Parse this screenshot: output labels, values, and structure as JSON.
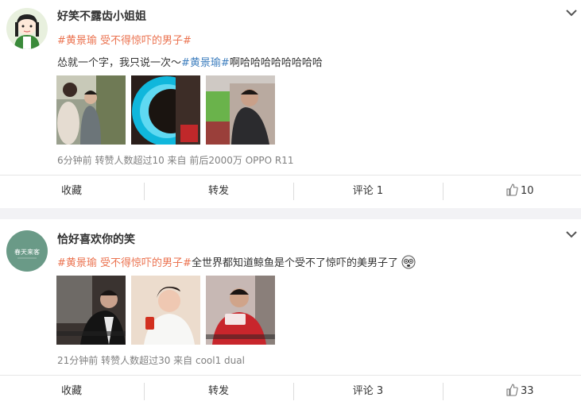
{
  "posts": [
    {
      "username": "好笑不露齿小姐姐",
      "tag_line": {
        "tag_a": "#黄景瑜",
        "tag_b": "受不得惊吓的男子#"
      },
      "text_line": {
        "prefix": "怂就一个字，我只说一次～",
        "tag": "#黄景瑜#",
        "suffix": "啊哈哈哈哈哈哈哈哈"
      },
      "meta": "6分钟前  转赞人数超过10  来自  前后2000万 OPPO R11",
      "actions": {
        "collect": "收藏",
        "repost": "转发",
        "comment": "评论 1",
        "likes": "10"
      }
    },
    {
      "username": "恰好喜欢你的笑",
      "avatar_text": "春天来客",
      "tag_line": {
        "tag_a": "#黄景瑜",
        "tag_b": "受不得惊吓的男子#",
        "suffix": "全世界都知道鲸鱼是个受不了惊吓的美男子了"
      },
      "meta": "21分钟前  转赞人数超过30  来自  cool1 dual",
      "actions": {
        "collect": "收藏",
        "repost": "转发",
        "comment": "评论 3",
        "likes": "33"
      }
    }
  ],
  "colors": {
    "tag": "#eb7350",
    "link": "#3f7fbf",
    "meta": "#808080",
    "page_bg": "#f2f2f5"
  },
  "icons": [
    "chevron-down-icon",
    "thumbs-up-icon",
    "emoji-icon"
  ]
}
